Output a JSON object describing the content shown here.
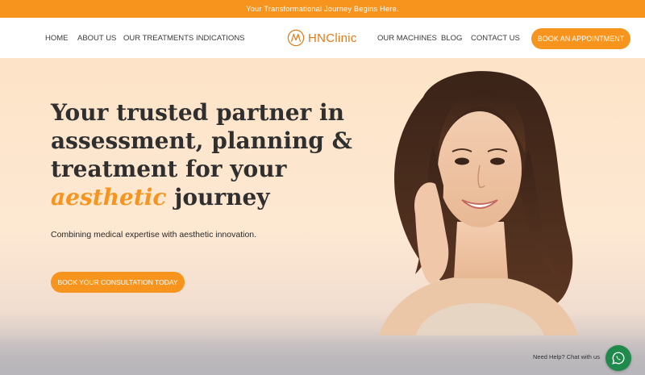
{
  "topbar": {
    "text": "Your Transformational Journey Begins Here."
  },
  "nav": {
    "left_links": [
      "HOME",
      "ABOUT US",
      "OUR TREATMENTS",
      "INDICATIONS"
    ],
    "logo_text": "HNClinic",
    "right_links": [
      "OUR MACHINES",
      "BLOG",
      "CONTACT US"
    ],
    "cta": "BOOK AN APPOINTMENT"
  },
  "hero": {
    "headline_lines": [
      "Your trusted partner in",
      "assessment, planning &",
      "treatment for your"
    ],
    "headline_accent": "aesthetic",
    "headline_end": "journey",
    "subtitle": "Combining medical expertise with aesthetic innovation.",
    "cta": "BOOK YOUR CONSULTATION TODAY"
  },
  "chat": {
    "label": "Need Help? Chat with us",
    "icon": "whatsapp-icon"
  },
  "colors": {
    "accent": "#f7941d",
    "hero_bg": "#fde8d0",
    "whatsapp": "#1f8a4c"
  }
}
